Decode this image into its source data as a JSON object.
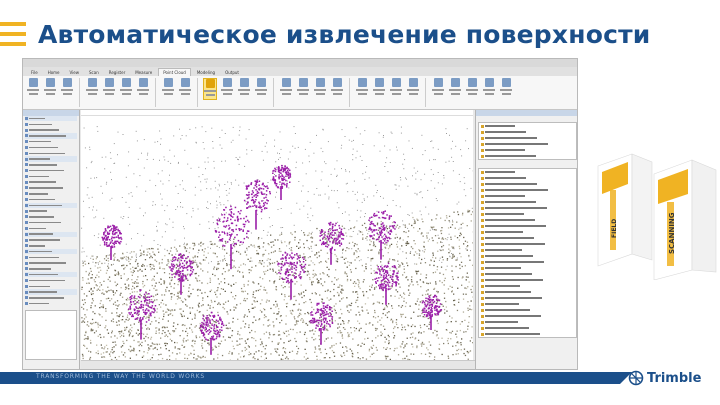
{
  "slide": {
    "title": "Автоматическое извлечение поверхности",
    "tagline": "TRANSFORMING THE WAY THE WORLD WORKS",
    "logo_text": "Trimble",
    "colors": {
      "brand_blue": "#1b4f8a",
      "accent_yellow": "#f0b323",
      "point_purple": "#9b1fa8"
    }
  },
  "app": {
    "tabs": [
      "File",
      "Home",
      "View",
      "Scan",
      "Register",
      "Measure",
      "Point Cloud",
      "Modeling",
      "Output"
    ],
    "active_tab": "Point Cloud",
    "highlighted_tool_icon": "extract-surface-icon"
  },
  "products": {
    "boxes": [
      "FIELD",
      "SCANNING"
    ]
  }
}
